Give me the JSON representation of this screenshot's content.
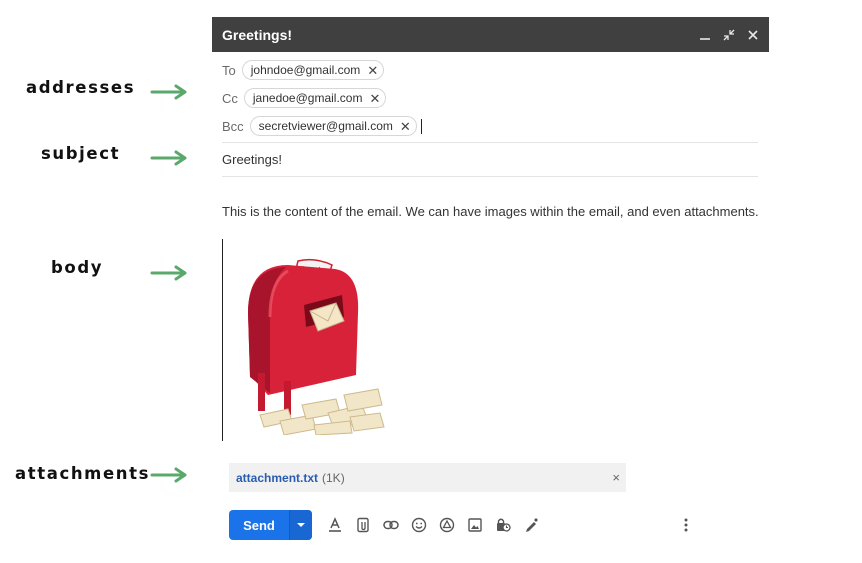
{
  "annotations": {
    "addresses": "addresses",
    "subject": "subject",
    "body": "body",
    "attachments": "attachments",
    "arrow_color": "#5aa86b"
  },
  "window": {
    "title": "Greetings!",
    "controls": [
      "minimize-icon",
      "exit-full-screen-icon",
      "close-icon"
    ]
  },
  "recipients": {
    "to_label": "To",
    "to": [
      "johndoe@gmail.com"
    ],
    "cc_label": "Cc",
    "cc": [
      "janedoe@gmail.com"
    ],
    "bcc_label": "Bcc",
    "bcc": [
      "secretviewer@gmail.com"
    ],
    "remove_glyph": "✕"
  },
  "subject": "Greetings!",
  "body": {
    "text": "This is the content of the email. We can have images within the email, and even attachments.",
    "image_label": "post"
  },
  "attachment": {
    "name": "attachment.txt",
    "size": "(1K)",
    "remove_glyph": "×"
  },
  "toolbar": {
    "send_label": "Send",
    "send_color": "#1a73e8",
    "tools": [
      "text-format-icon",
      "attach-file-icon",
      "insert-link-icon",
      "emoji-icon",
      "google-drive-icon",
      "insert-photo-icon",
      "confidential-mode-icon",
      "signature-icon"
    ],
    "more": "more-options-icon"
  }
}
